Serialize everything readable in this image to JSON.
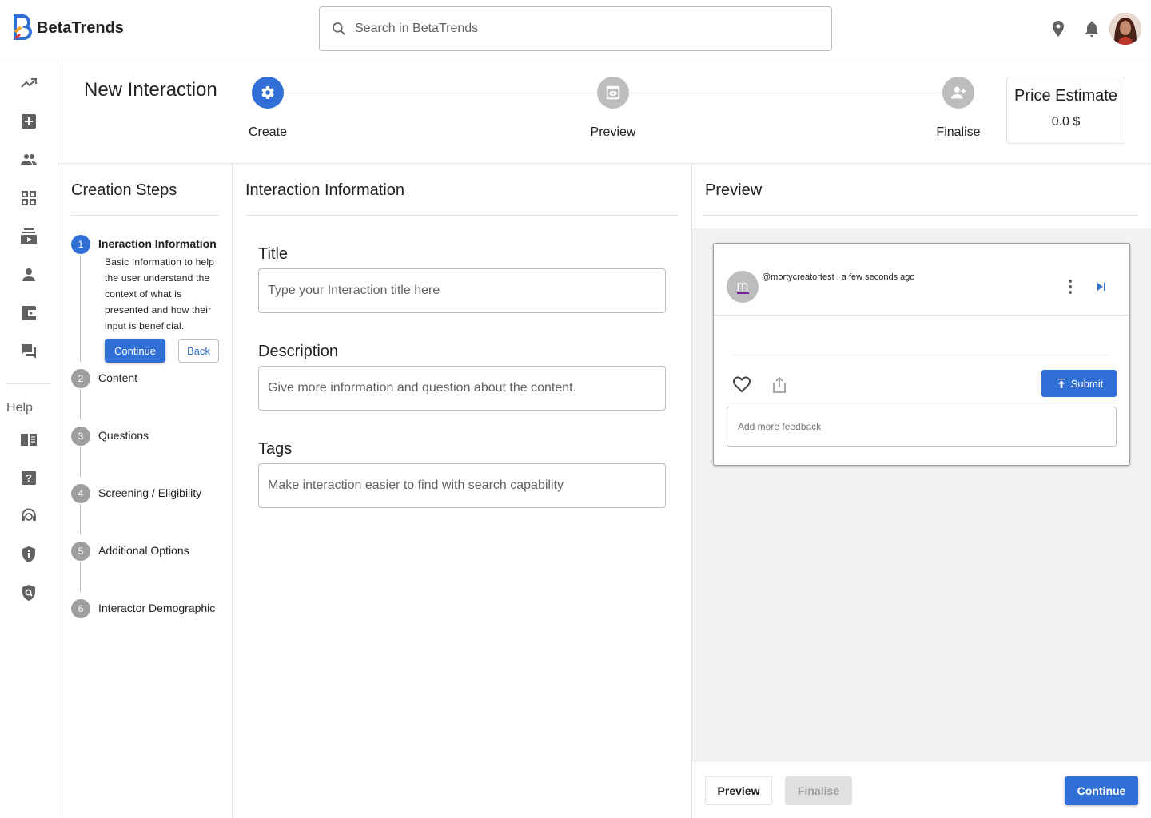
{
  "app": {
    "name": "BetaTrends",
    "brand_color": "#2f6fd6"
  },
  "search": {
    "placeholder": "Search in BetaTrends"
  },
  "rail": {
    "help_label": "Help",
    "icons": [
      "trending-up-icon",
      "add-box-icon",
      "people-icon",
      "grid-view-icon",
      "subscriptions-icon",
      "person-icon",
      "wallet-icon",
      "forum-icon",
      "menu-book-icon",
      "help-icon",
      "support-agent-icon",
      "policy-icon",
      "security-search-icon"
    ]
  },
  "header": {
    "title": "New Interaction",
    "steps": [
      {
        "label": "Create",
        "active": true,
        "icon": "settings-icon"
      },
      {
        "label": "Preview",
        "active": false,
        "icon": "preview-icon"
      },
      {
        "label": "Finalise",
        "active": false,
        "icon": "person-add-icon"
      }
    ],
    "price_estimate": {
      "title": "Price Estimate",
      "value": "0.0 $"
    }
  },
  "creation_steps": {
    "title": "Creation Steps",
    "items": [
      {
        "number": "1",
        "label": "Ineraction Information",
        "active": true,
        "description": "Basic Information to help the user understand the context of what is presented and how their input is beneficial."
      },
      {
        "number": "2",
        "label": "Content",
        "active": false
      },
      {
        "number": "3",
        "label": "Questions",
        "active": false
      },
      {
        "number": "4",
        "label": "Screening / Eligibility",
        "active": false
      },
      {
        "number": "5",
        "label": "Additional Options",
        "active": false
      },
      {
        "number": "6",
        "label": "Interactor Demographic",
        "active": false
      }
    ],
    "continue_label": "Continue",
    "back_label": "Back"
  },
  "interaction_info": {
    "title": "Interaction Information",
    "fields": [
      {
        "label": "Title",
        "placeholder": "Type your Interaction title here",
        "value": ""
      },
      {
        "label": "Description",
        "placeholder": "Give more information and question about the content.",
        "value": ""
      },
      {
        "label": "Tags",
        "placeholder": "Make interaction easier to find with search capability",
        "value": ""
      }
    ]
  },
  "preview": {
    "title": "Preview",
    "card": {
      "avatar_letter": "m",
      "user_line": "@mortycreatortest . a few seconds ago",
      "submit_label": "Submit",
      "feedback_placeholder": "Add more feedback"
    },
    "footer": {
      "preview_label": "Preview",
      "finalise_label": "Finalise",
      "continue_label": "Continue"
    }
  }
}
